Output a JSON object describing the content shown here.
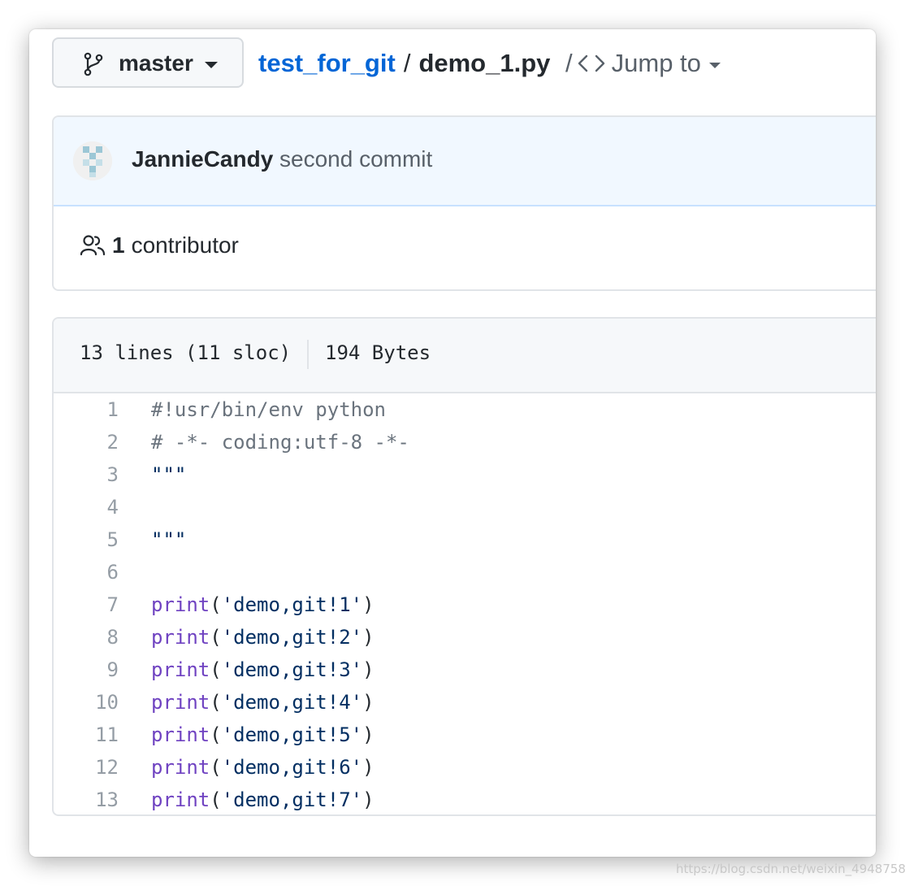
{
  "branch": {
    "label": "master",
    "icon": "git-branch-icon"
  },
  "breadcrumb": {
    "repo": "test_for_git",
    "separator": "/",
    "file": "demo_1.py",
    "jump_separator": "/",
    "jump_label": "Jump to"
  },
  "commit": {
    "author": "JannieCandy",
    "message": "second commit",
    "avatar": "identicon-avatar"
  },
  "contributors": {
    "count": "1",
    "label": "contributor",
    "icon": "people-icon"
  },
  "file": {
    "lines_info": "13 lines (11 sloc)",
    "size": "194 Bytes"
  },
  "code": {
    "lines": [
      {
        "number": "1",
        "tokens": [
          {
            "t": "#!usr/bin/env python",
            "k": "comment"
          }
        ]
      },
      {
        "number": "2",
        "tokens": [
          {
            "t": "# -*- coding:utf-8 -*-",
            "k": "comment"
          }
        ]
      },
      {
        "number": "3",
        "tokens": [
          {
            "t": "\"\"\"",
            "k": "string"
          }
        ]
      },
      {
        "number": "4",
        "tokens": []
      },
      {
        "number": "5",
        "tokens": [
          {
            "t": "\"\"\"",
            "k": "string"
          }
        ]
      },
      {
        "number": "6",
        "tokens": []
      },
      {
        "number": "7",
        "tokens": [
          {
            "t": "print",
            "k": "builtin"
          },
          {
            "t": "(",
            "k": "plain"
          },
          {
            "t": "'demo,git!1'",
            "k": "string"
          },
          {
            "t": ")",
            "k": "plain"
          }
        ]
      },
      {
        "number": "8",
        "tokens": [
          {
            "t": "print",
            "k": "builtin"
          },
          {
            "t": "(",
            "k": "plain"
          },
          {
            "t": "'demo,git!2'",
            "k": "string"
          },
          {
            "t": ")",
            "k": "plain"
          }
        ]
      },
      {
        "number": "9",
        "tokens": [
          {
            "t": "print",
            "k": "builtin"
          },
          {
            "t": "(",
            "k": "plain"
          },
          {
            "t": "'demo,git!3'",
            "k": "string"
          },
          {
            "t": ")",
            "k": "plain"
          }
        ]
      },
      {
        "number": "10",
        "tokens": [
          {
            "t": "print",
            "k": "builtin"
          },
          {
            "t": "(",
            "k": "plain"
          },
          {
            "t": "'demo,git!4'",
            "k": "string"
          },
          {
            "t": ")",
            "k": "plain"
          }
        ]
      },
      {
        "number": "11",
        "tokens": [
          {
            "t": "print",
            "k": "builtin"
          },
          {
            "t": "(",
            "k": "plain"
          },
          {
            "t": "'demo,git!5'",
            "k": "string"
          },
          {
            "t": ")",
            "k": "plain"
          }
        ]
      },
      {
        "number": "12",
        "tokens": [
          {
            "t": "print",
            "k": "builtin"
          },
          {
            "t": "(",
            "k": "plain"
          },
          {
            "t": "'demo,git!6'",
            "k": "string"
          },
          {
            "t": ")",
            "k": "plain"
          }
        ]
      },
      {
        "number": "13",
        "tokens": [
          {
            "t": "print",
            "k": "builtin"
          },
          {
            "t": "(",
            "k": "plain"
          },
          {
            "t": "'demo,git!7'",
            "k": "string"
          },
          {
            "t": ")",
            "k": "plain"
          }
        ]
      }
    ]
  },
  "watermark": "https://blog.csdn.net/weixin_4948758"
}
